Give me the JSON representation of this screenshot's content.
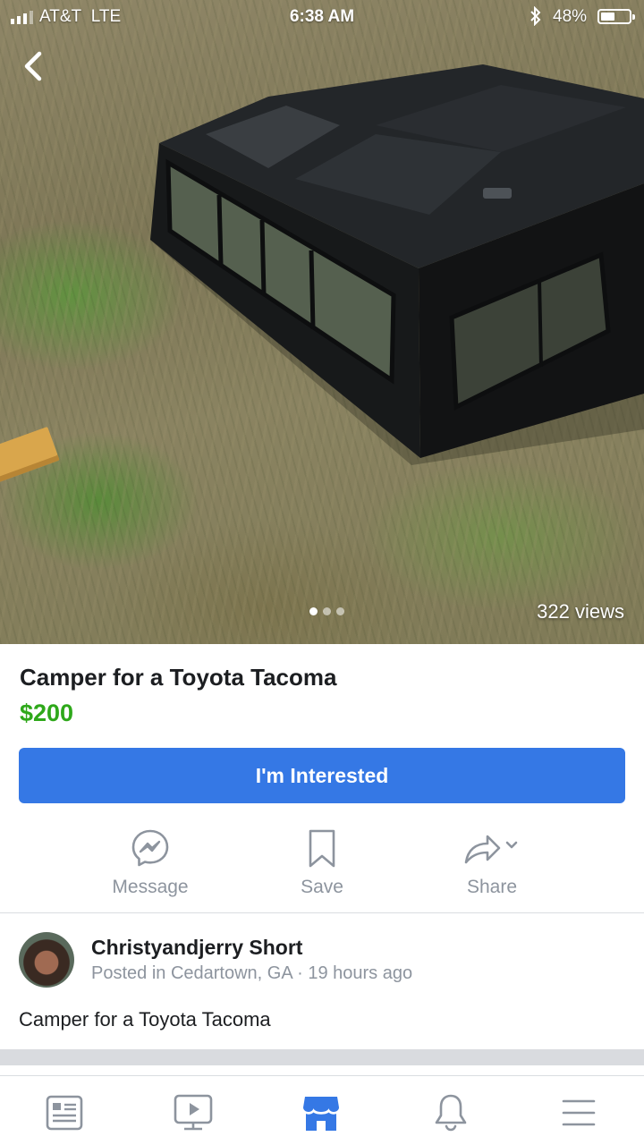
{
  "status_bar": {
    "carrier": "AT&T",
    "network": "LTE",
    "time": "6:38 AM",
    "battery": "48%"
  },
  "listing": {
    "views": "322 views",
    "photo_count": 3,
    "current_photo": 1,
    "title": "Camper for a Toyota Tacoma",
    "price": "$200",
    "interested_label": "I'm Interested"
  },
  "actions": {
    "message": "Message",
    "save": "Save",
    "share": "Share"
  },
  "seller": {
    "name": "Christyandjerry Short",
    "meta": "Posted in Cedartown, GA · 19 hours ago"
  },
  "description": "Camper for a Toyota Tacoma",
  "icons": {
    "back": "chevron-left-icon",
    "message": "messenger-icon",
    "save": "bookmark-icon",
    "share": "share-arrow-icon",
    "tabs": [
      "news-feed-icon",
      "watch-icon",
      "marketplace-icon",
      "bell-icon",
      "menu-icon"
    ]
  },
  "colors": {
    "accent": "#3578e5",
    "price": "#2ea81a",
    "active_tab": "#3578e5",
    "inactive": "#8d949e"
  },
  "tabs": {
    "active": "marketplace"
  }
}
